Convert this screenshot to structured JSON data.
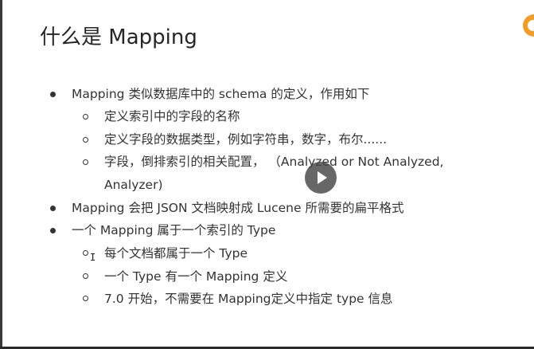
{
  "slide": {
    "title": "什么是 Mapping",
    "bullets": [
      "Mapping 类似数据库中的 schema 的定义，作用如下",
      "Mapping 会把 JSON 文档映射成 Lucene 所需要的扁平格式",
      "一个 Mapping 属于一个索引的 Type"
    ],
    "sub_bullets_1": [
      "定义索引中的字段的名称",
      "定义字段的数据类型，例如字符串，数字，布尔......",
      "字段，倒排索引的相关配置，  （Analyzed or Not Analyzed,",
      "Analyzer)"
    ],
    "sub_bullets_3": [
      "每个文档都属于一个 Type",
      "一个 Type 有一个 Mapping 定义",
      "7.0 开始，不需要在 Mapping定义中指定 type 信息"
    ]
  },
  "overlay": {
    "play_icon": "play-icon",
    "cursor_icon": "text-cursor-icon",
    "cursor_glyph": "I",
    "logo_color": "#f39c26"
  }
}
